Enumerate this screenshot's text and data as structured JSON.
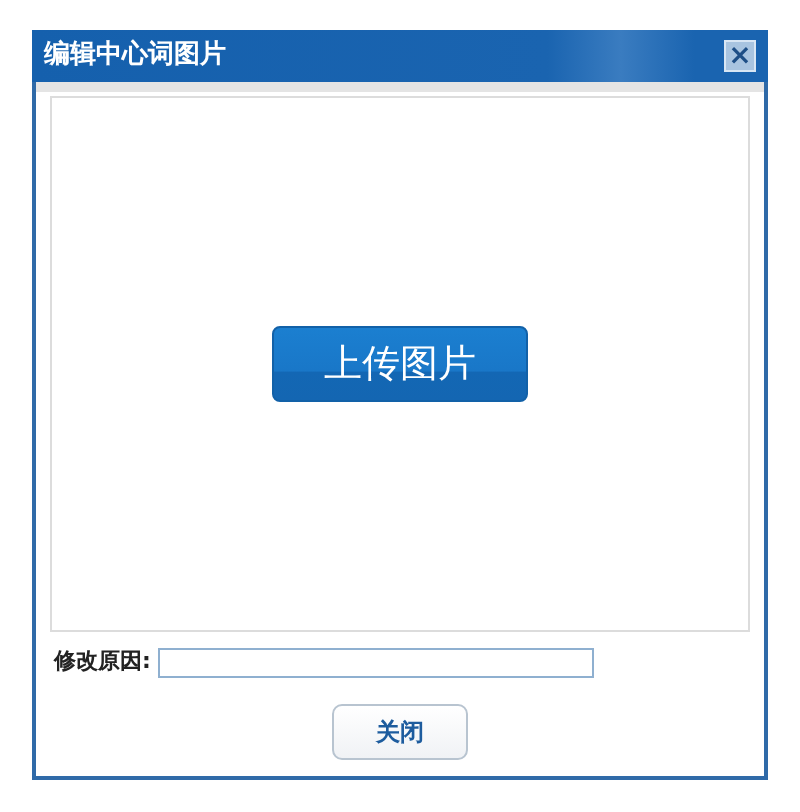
{
  "window": {
    "title": "编辑中心词图片",
    "close": "×"
  },
  "upload_button": "上传图片",
  "reason": {
    "label": "修改原因:"
  },
  "buttons": [
    "关闭"
  ]
}
